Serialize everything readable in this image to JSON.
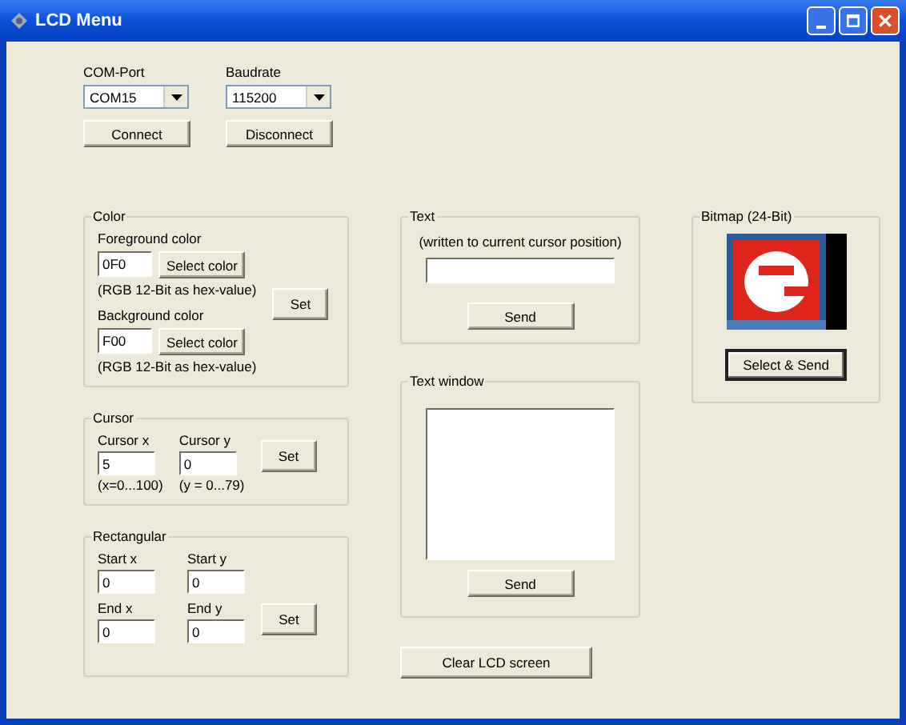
{
  "window": {
    "title": "LCD Menu"
  },
  "connection": {
    "com_port": {
      "label": "COM-Port",
      "value": "COM15"
    },
    "baudrate": {
      "label": "Baudrate",
      "value": "115200"
    },
    "buttons": [
      "Connect",
      "Disconnect"
    ]
  },
  "color": {
    "title": "Color",
    "entries": [
      {
        "label": "Foreground color",
        "value": "0F0",
        "button": "Select color",
        "hint": "(RGB 12-Bit as hex-value)"
      },
      {
        "label": "Background color",
        "value": "F00",
        "button": "Select color",
        "hint": "(RGB 12-Bit as hex-value)"
      }
    ],
    "set_button": "Set"
  },
  "cursor": {
    "title": "Cursor",
    "fields": [
      {
        "label": "Cursor x",
        "value": "5",
        "hint": "(x=0...100)"
      },
      {
        "label": "Cursor y",
        "value": "0",
        "hint": "(y = 0...79)"
      }
    ],
    "set_button": "Set"
  },
  "rectangular": {
    "title": "Rectangular",
    "fields": [
      {
        "label": "Start x",
        "value": "0"
      },
      {
        "label": "Start y",
        "value": "0"
      },
      {
        "label": "End x",
        "value": "0"
      },
      {
        "label": "End y",
        "value": "0"
      }
    ],
    "set_button": "Set"
  },
  "text": {
    "title": "Text",
    "caption": "(written to current cursor position)",
    "send_button": "Send"
  },
  "text_window": {
    "title": "Text window",
    "send_button": "Send"
  },
  "clear_button": "Clear LCD screen",
  "bitmap": {
    "title": "Bitmap (24-Bit)",
    "button": "Select & Send"
  }
}
